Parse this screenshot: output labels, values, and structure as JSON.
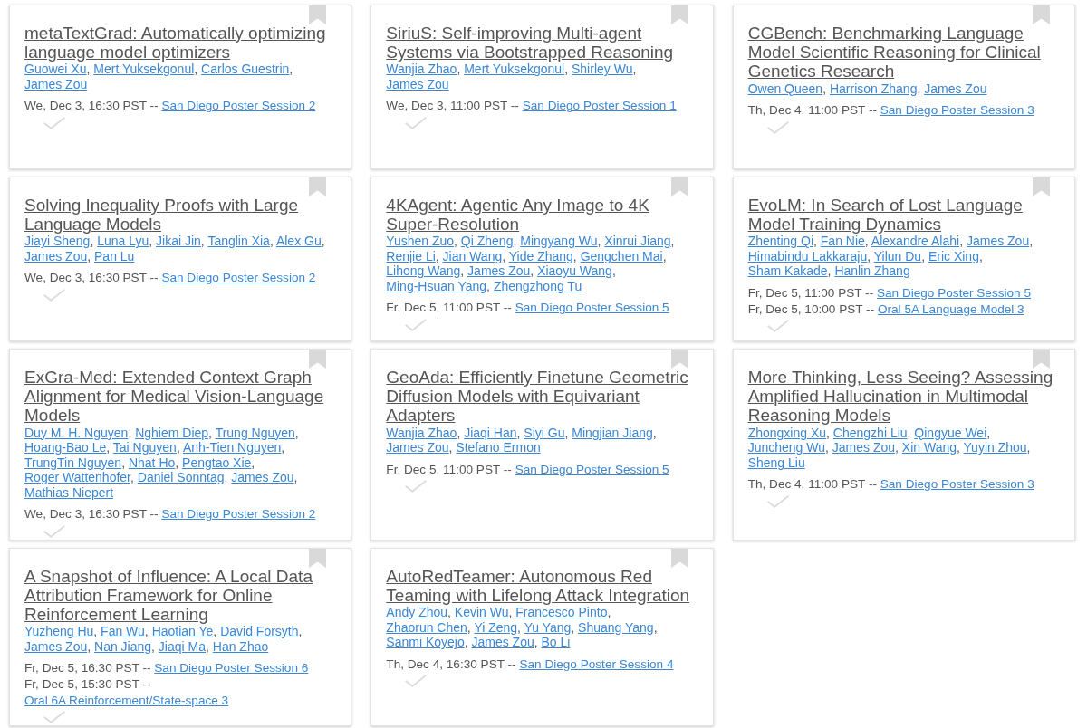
{
  "author_separator": ",",
  "papers": [
    {
      "title": "metaTextGrad: Automatically optimizing language model optimizers",
      "authors": [
        "Guowei Xu",
        "Mert Yuksekgonul",
        "Carlos Guestrin",
        "James Zou"
      ],
      "sessions": [
        {
          "time": "We, Dec 3, 16:30 PST --",
          "name": "San Diego Poster Session 2"
        }
      ],
      "bookmarked": false,
      "checked": false
    },
    {
      "title": "SiriuS: Self-improving Multi-agent Systems via Bootstrapped Reasoning",
      "authors": [
        "Wanjia Zhao",
        "Mert Yuksekgonul",
        "Shirley Wu",
        "James Zou"
      ],
      "sessions": [
        {
          "time": "We, Dec 3, 11:00 PST --",
          "name": "San Diego Poster Session 1"
        }
      ],
      "bookmarked": false,
      "checked": false
    },
    {
      "title": "CGBench: Benchmarking Language Model Scientific Reasoning for Clinical Genetics Research",
      "authors": [
        "Owen Queen",
        "Harrison Zhang",
        "James Zou"
      ],
      "sessions": [
        {
          "time": "Th, Dec 4, 11:00 PST --",
          "name": "San Diego Poster Session 3"
        }
      ],
      "bookmarked": false,
      "checked": false
    },
    {
      "title": "Solving Inequality Proofs with Large Language Models",
      "authors": [
        "Jiayi Sheng",
        "Luna Lyu",
        "Jikai Jin",
        "Tanglin Xia",
        "Alex Gu",
        "James Zou",
        "Pan Lu"
      ],
      "sessions": [
        {
          "time": "We, Dec 3, 16:30 PST --",
          "name": "San Diego Poster Session 2"
        }
      ],
      "bookmarked": false,
      "checked": false
    },
    {
      "title": "4KAgent: Agentic Any Image to 4K Super-Resolution",
      "authors": [
        "Yushen Zuo",
        "Qi Zheng",
        "Mingyang Wu",
        "Xinrui Jiang",
        "Renjie Li",
        "Jian Wang",
        "Yide Zhang",
        "Gengchen Mai",
        "Lihong Wang",
        "James Zou",
        "Xiaoyu Wang",
        "Ming-Hsuan Yang",
        "Zhengzhong Tu"
      ],
      "sessions": [
        {
          "time": "Fr, Dec 5, 11:00 PST --",
          "name": "San Diego Poster Session 5"
        }
      ],
      "bookmarked": false,
      "checked": false
    },
    {
      "title": "EvoLM: In Search of Lost Language Model Training Dynamics",
      "authors": [
        "Zhenting Qi",
        "Fan Nie",
        "Alexandre Alahi",
        "James Zou",
        "Himabindu Lakkaraju",
        "Yilun Du",
        "Eric Xing",
        "Sham Kakade",
        "Hanlin Zhang"
      ],
      "sessions": [
        {
          "time": "Fr, Dec 5, 11:00 PST --",
          "name": "San Diego Poster Session 5"
        },
        {
          "time": "Fr, Dec 5, 10:00 PST --",
          "name": "Oral 5A Language Model 3"
        }
      ],
      "bookmarked": false,
      "checked": false
    },
    {
      "title": "ExGra-Med: Extended Context Graph Alignment for Medical Vision-Language Models",
      "authors": [
        "Duy M. H. Nguyen",
        "Nghiem Diep",
        "Trung Nguyen",
        "Hoang-Bao Le",
        "Tai Nguyen",
        "Anh-Tien Nguyen",
        "TrungTin Nguyen",
        "Nhat Ho",
        "Pengtao Xie",
        "Roger Wattenhofer",
        "Daniel Sonntag",
        "James Zou",
        "Mathias Niepert"
      ],
      "sessions": [
        {
          "time": "We, Dec 3, 16:30 PST --",
          "name": "San Diego Poster Session 2"
        }
      ],
      "bookmarked": false,
      "checked": false
    },
    {
      "title": "GeoAda: Efficiently Finetune Geometric Diffusion Models with Equivariant Adapters",
      "authors": [
        "Wanjia Zhao",
        "Jiaqi Han",
        "Siyi Gu",
        "Mingjian Jiang",
        "James Zou",
        "Stefano Ermon"
      ],
      "sessions": [
        {
          "time": "Fr, Dec 5, 11:00 PST --",
          "name": "San Diego Poster Session 5"
        }
      ],
      "bookmarked": false,
      "checked": false
    },
    {
      "title": "More Thinking, Less Seeing? Assessing Amplified Hallucination in Multimodal Reasoning Models",
      "authors": [
        "Zhongxing Xu",
        "Chengzhi Liu",
        "Qingyue Wei",
        "Juncheng Wu",
        "James Zou",
        "Xin Wang",
        "Yuyin Zhou",
        "Sheng Liu"
      ],
      "sessions": [
        {
          "time": "Th, Dec 4, 11:00 PST --",
          "name": "San Diego Poster Session 3"
        }
      ],
      "bookmarked": false,
      "checked": false
    },
    {
      "title": "A Snapshot of Influence: A Local Data Attribution Framework for Online Reinforcement Learning",
      "authors": [
        "Yuzheng Hu",
        "Fan Wu",
        "Haotian Ye",
        "David Forsyth",
        "James Zou",
        "Nan Jiang",
        "Jiaqi Ma",
        "Han Zhao"
      ],
      "sessions": [
        {
          "time": "Fr, Dec 5, 16:30 PST --",
          "name": "San Diego Poster Session 6"
        },
        {
          "time": "Fr, Dec 5, 15:30 PST --",
          "name": "Oral 6A Reinforcement/State-space 3"
        }
      ],
      "bookmarked": false,
      "checked": false
    },
    {
      "title": "AutoRedTeamer: Autonomous Red Teaming with Lifelong Attack Integration",
      "authors": [
        "Andy Zhou",
        "Kevin Wu",
        "Francesco Pinto",
        "Zhaorun Chen",
        "Yi Zeng",
        "Yu Yang",
        "Shuang Yang",
        "Sanmi Koyejo",
        "James Zou",
        "Bo Li"
      ],
      "sessions": [
        {
          "time": "Th, Dec 4, 16:30 PST --",
          "name": "San Diego Poster Session 4"
        }
      ],
      "bookmarked": false,
      "checked": false
    }
  ]
}
